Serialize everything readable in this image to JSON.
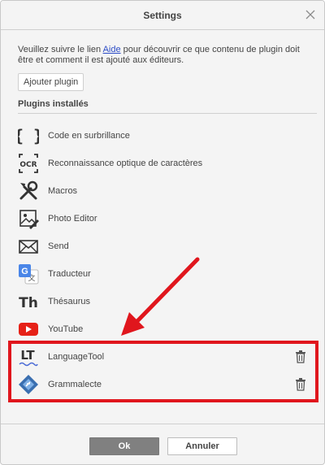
{
  "dialog": {
    "title": "Settings"
  },
  "intro": {
    "text_before": "Veuillez suivre le lien ",
    "link": "Aide",
    "text_after": " pour découvrir ce que contenu de plugin doit être et comment il est ajouté aux éditeurs."
  },
  "add_plugin_label": "Ajouter plugin",
  "installed_title": "Plugins installés",
  "plugins": [
    {
      "label": "Code en surbrillance",
      "icon": "braces-icon"
    },
    {
      "label": "Reconnaissance optique de caractères",
      "icon": "ocr-icon",
      "icon_text": "OCR"
    },
    {
      "label": "Macros",
      "icon": "tools-icon"
    },
    {
      "label": "Photo Editor",
      "icon": "photo-editor-icon"
    },
    {
      "label": "Send",
      "icon": "envelope-icon"
    },
    {
      "label": "Traducteur",
      "icon": "google-translate-icon",
      "icon_text": "G"
    },
    {
      "label": "Thésaurus",
      "icon": "thesaurus-icon",
      "icon_text": "Th"
    },
    {
      "label": "YouTube",
      "icon": "youtube-icon"
    },
    {
      "label": "LanguageTool",
      "icon": "languagetool-icon",
      "icon_text": "LT",
      "deletable": true
    },
    {
      "label": "Grammalecte",
      "icon": "grammalecte-icon",
      "deletable": true
    }
  ],
  "footer": {
    "ok_label": "Ok",
    "cancel_label": "Annuler"
  },
  "colors": {
    "highlight": "#e0161d",
    "link": "#2c4cc6",
    "ok_button": "#808080",
    "youtube": "#e62117",
    "google_blue": "#4a86e8"
  }
}
